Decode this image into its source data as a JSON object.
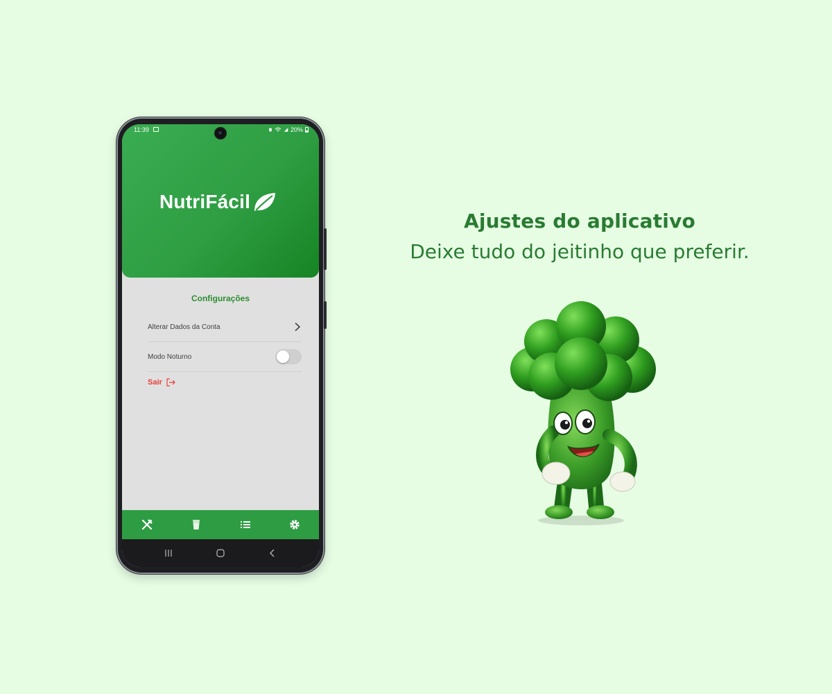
{
  "colors": {
    "page_background": "#e6fde4",
    "brand_green": "#2e9c43",
    "headline_green": "#2a7b32",
    "logout_red": "#e5403a",
    "screen_background": "#e1e0e1"
  },
  "status_bar": {
    "time": "11:39",
    "battery": "20%",
    "icons": [
      "image-icon",
      "battery-saver-icon",
      "wifi-icon",
      "signal-icon",
      "battery-icon"
    ]
  },
  "app": {
    "logo_text": "NutriFácil",
    "logo_icon": "leaf-icon"
  },
  "settings": {
    "title": "Configurações",
    "items": [
      {
        "label": "Alterar Dados da Conta",
        "control": "chevron-right-icon"
      },
      {
        "label": "Modo Noturno",
        "control": "toggle",
        "enabled": false
      }
    ],
    "logout_label": "Sair",
    "logout_icon": "logout-icon"
  },
  "tab_bar": {
    "items": [
      {
        "icon": "utensils-icon",
        "active": false
      },
      {
        "icon": "glass-icon",
        "active": false
      },
      {
        "icon": "list-icon",
        "active": false
      },
      {
        "icon": "gear-icon",
        "active": true
      }
    ]
  },
  "system_nav": {
    "buttons": [
      "recents-icon",
      "home-icon",
      "back-icon"
    ]
  },
  "promo": {
    "headline": "Ajustes do aplicativo",
    "subline": "Deixe tudo do jeitinho que preferir.",
    "mascot": "broccoli-mascot"
  }
}
